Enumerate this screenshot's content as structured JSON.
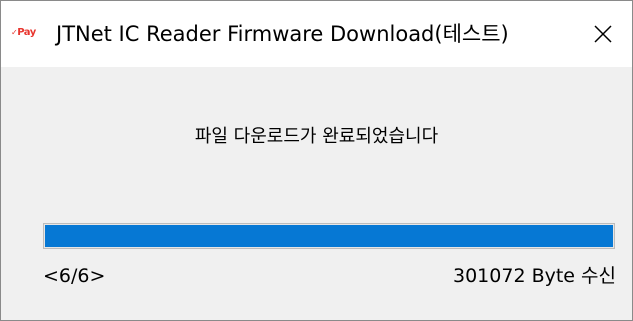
{
  "window": {
    "logo_text": "Pay",
    "title": "JTNet IC Reader Firmware Download(테스트)",
    "close_icon": "close-icon"
  },
  "dialog": {
    "message": "파일 다운로드가 완료되었습니다",
    "progress_percent": 100,
    "step_counter": "<6/6>",
    "bytes_received": "301072 Byte 수신"
  },
  "colors": {
    "progress_fill": "#0678d4",
    "logo": "#e8362f",
    "window_bg": "#f0f0f0"
  }
}
